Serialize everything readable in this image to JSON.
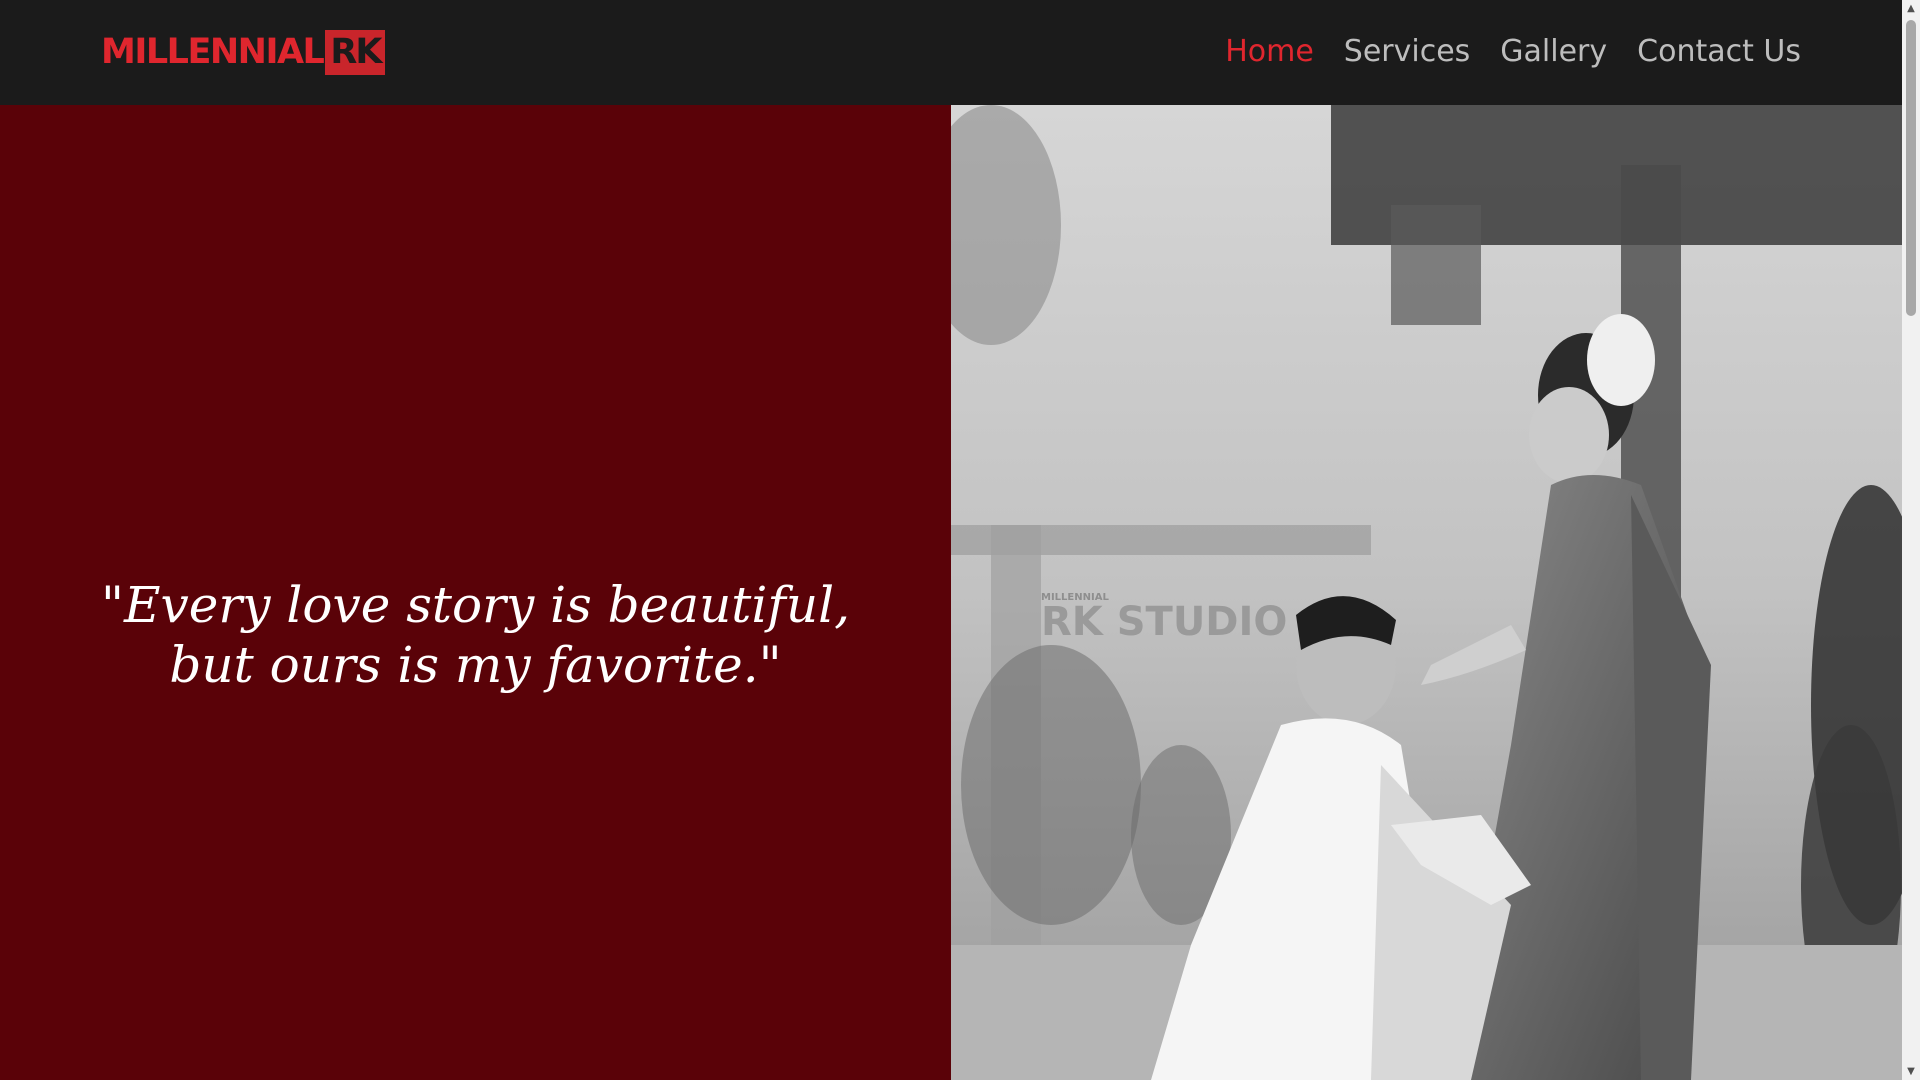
{
  "header": {
    "logo": {
      "text": "MILLENNIAL",
      "box_text": "RK"
    },
    "nav": [
      {
        "label": "Home",
        "active": true
      },
      {
        "label": "Services",
        "active": false
      },
      {
        "label": "Gallery",
        "active": false
      },
      {
        "label": "Contact Us",
        "active": false
      }
    ]
  },
  "hero": {
    "quote_line1": "\"Every love story is beautiful,",
    "quote_line2": "but ours is my favorite.\"",
    "image": {
      "description_icon": "wedding-couple-photo",
      "watermark_small": "MILLENNIAL",
      "watermark": "RK STUDIO"
    }
  },
  "colors": {
    "accent": "#e0262e",
    "hero_left_bg": "#5a0208",
    "header_bg": "#1b1b1b",
    "nav_text": "#bdbdbd"
  }
}
